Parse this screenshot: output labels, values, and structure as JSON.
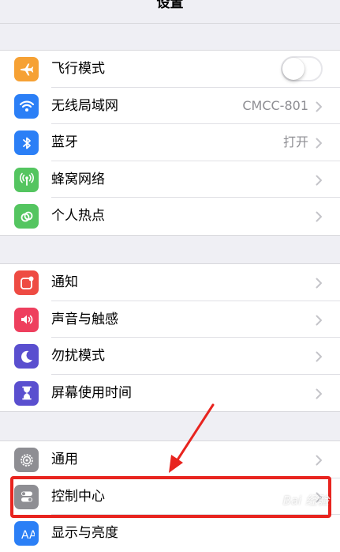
{
  "header": {
    "title": "设置"
  },
  "groups": [
    {
      "items": [
        {
          "label": "飞行模式",
          "icon": "airplane-icon",
          "color": "#f6a134",
          "toggle": false
        },
        {
          "label": "无线局域网",
          "icon": "wifi-icon",
          "color": "#2b7ff6",
          "value": "CMCC-801"
        },
        {
          "label": "蓝牙",
          "icon": "bluetooth-icon",
          "color": "#2b7ff6",
          "value": "打开"
        },
        {
          "label": "蜂窝网络",
          "icon": "antenna-icon",
          "color": "#54c560"
        },
        {
          "label": "个人热点",
          "icon": "hotspot-icon",
          "color": "#54c560"
        }
      ]
    },
    {
      "items": [
        {
          "label": "通知",
          "icon": "notification-icon",
          "color": "#ee4b43"
        },
        {
          "label": "声音与触感",
          "icon": "speaker-icon",
          "color": "#ee3f5e"
        },
        {
          "label": "勿扰模式",
          "icon": "moon-icon",
          "color": "#5a4fcf"
        },
        {
          "label": "屏幕使用时间",
          "icon": "hourglass-icon",
          "color": "#5a4fcf"
        }
      ]
    },
    {
      "items": [
        {
          "label": "通用",
          "icon": "gear-icon",
          "color": "#8e8e93"
        },
        {
          "label": "控制中心",
          "icon": "switches-icon",
          "color": "#8e8e93"
        },
        {
          "label": "显示与亮度",
          "icon": "display-icon",
          "color": "#2b7ff6"
        }
      ]
    }
  ],
  "annotation": {
    "highlight_color": "#e8241f"
  },
  "watermark": "Bai 经验"
}
